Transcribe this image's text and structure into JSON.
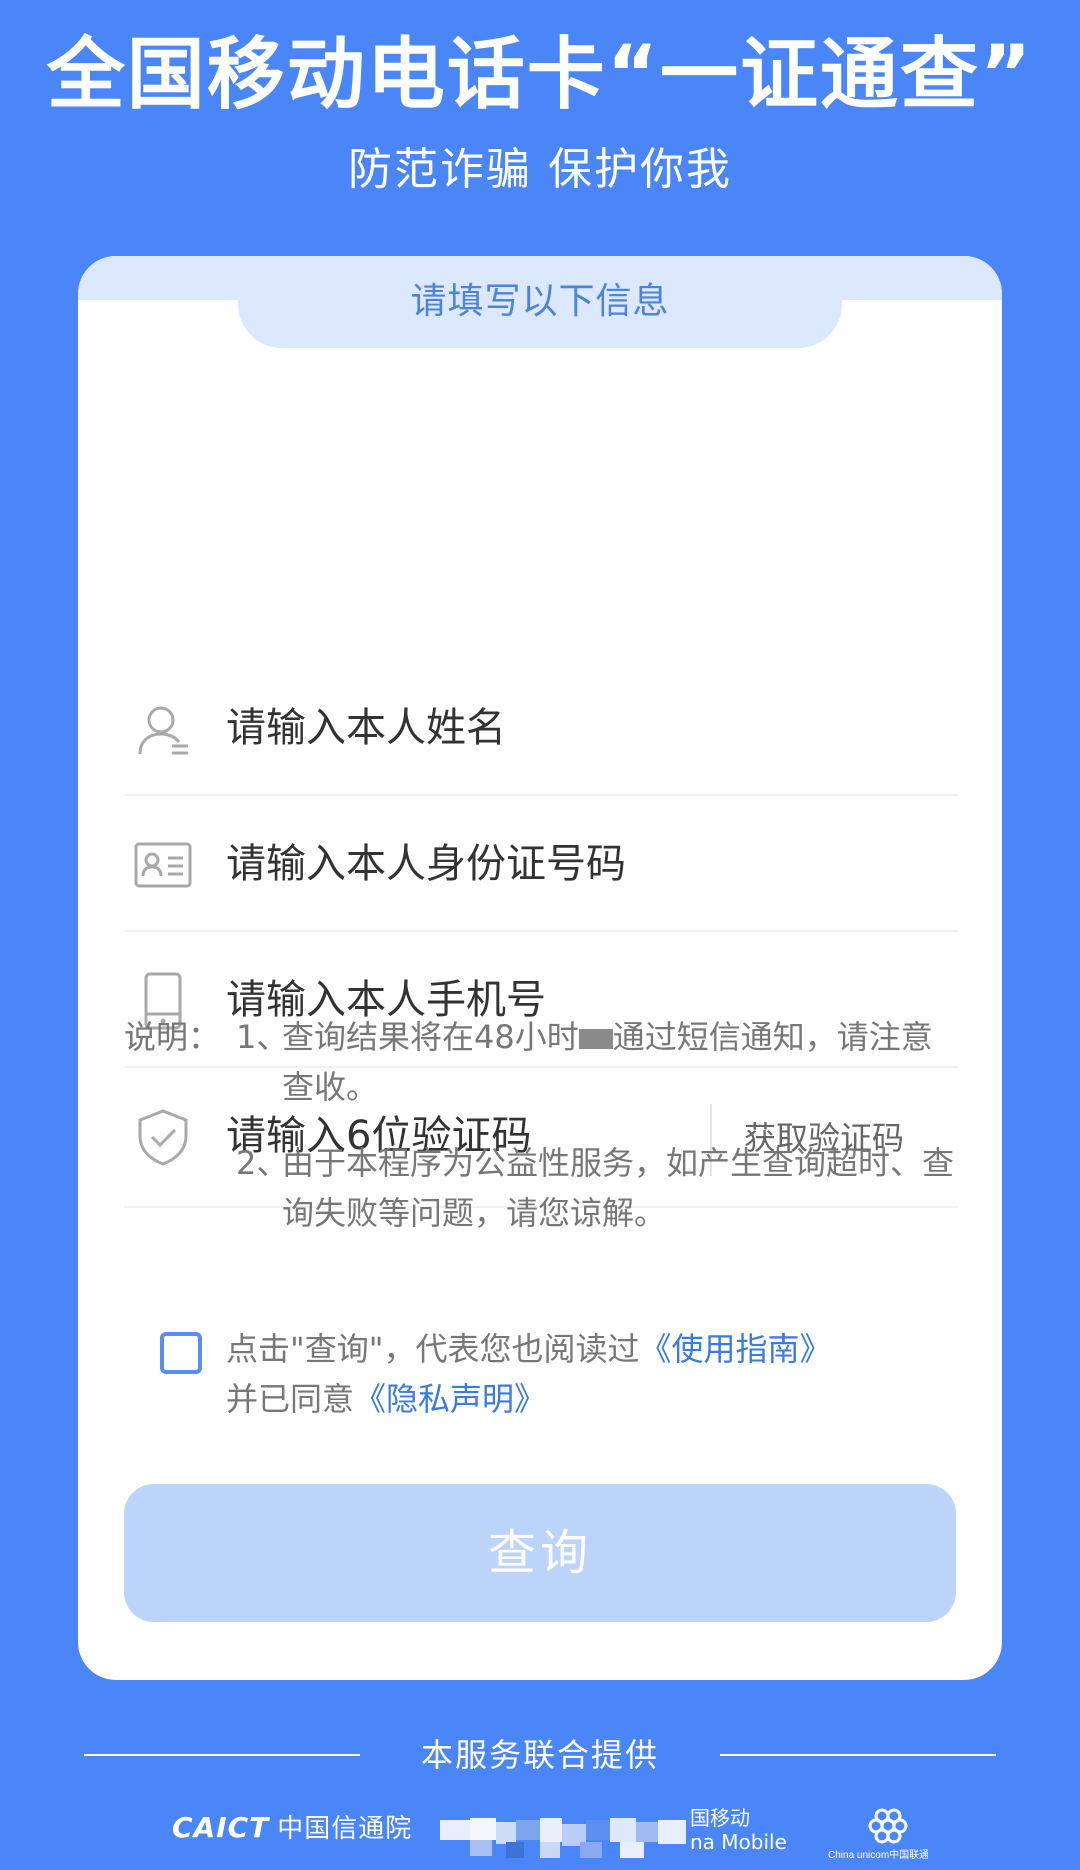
{
  "header": {
    "title": "全国移动电话卡“一证通查”",
    "subtitle": "防范诈骗 保护你我"
  },
  "card": {
    "tab_label": "请填写以下信息"
  },
  "form": {
    "name_placeholder": "请输入本人姓名",
    "id_placeholder": "请输入本人身份证号码",
    "phone_placeholder": "请输入本人手机号",
    "code_placeholder": "请输入6位验证码",
    "get_code_label": "获取验证码"
  },
  "notes": {
    "label": "说明：",
    "item1_num": "1、",
    "item1_text_a": "查询结果将在48小时",
    "item1_text_b": "通过短信通知，请注意查收。",
    "item2_num": "2、",
    "item2_text": "由于本程序为公益性服务，如产生查询超时、查询失败等问题，请您谅解。"
  },
  "agreement": {
    "line1_prefix": "点击\"查询\"，代表您也阅读过",
    "guide_link": "《使用指南》",
    "line2_prefix": "并已同意",
    "privacy_link": "《隐私声明》"
  },
  "actions": {
    "query_label": "查询"
  },
  "footer": {
    "provided_by": "本服务联合提供",
    "caict_en": "CAICT",
    "caict_cn": "中国信通院",
    "mobile_cn": "国移动",
    "mobile_en": "na Mobile",
    "unicom_en": "China unicom中国联通"
  },
  "colors": {
    "background": "#4a86f7",
    "card": "#ffffff",
    "tab_band": "#dbe8fd",
    "tab_text": "#4d83d8",
    "link": "#3a7be0",
    "button_disabled": "#bcd3fa",
    "checkbox_border": "#5a8ef5"
  },
  "icons": {
    "name": "user-icon",
    "id": "id-card-icon",
    "phone": "phone-icon",
    "code": "shield-check-icon"
  }
}
